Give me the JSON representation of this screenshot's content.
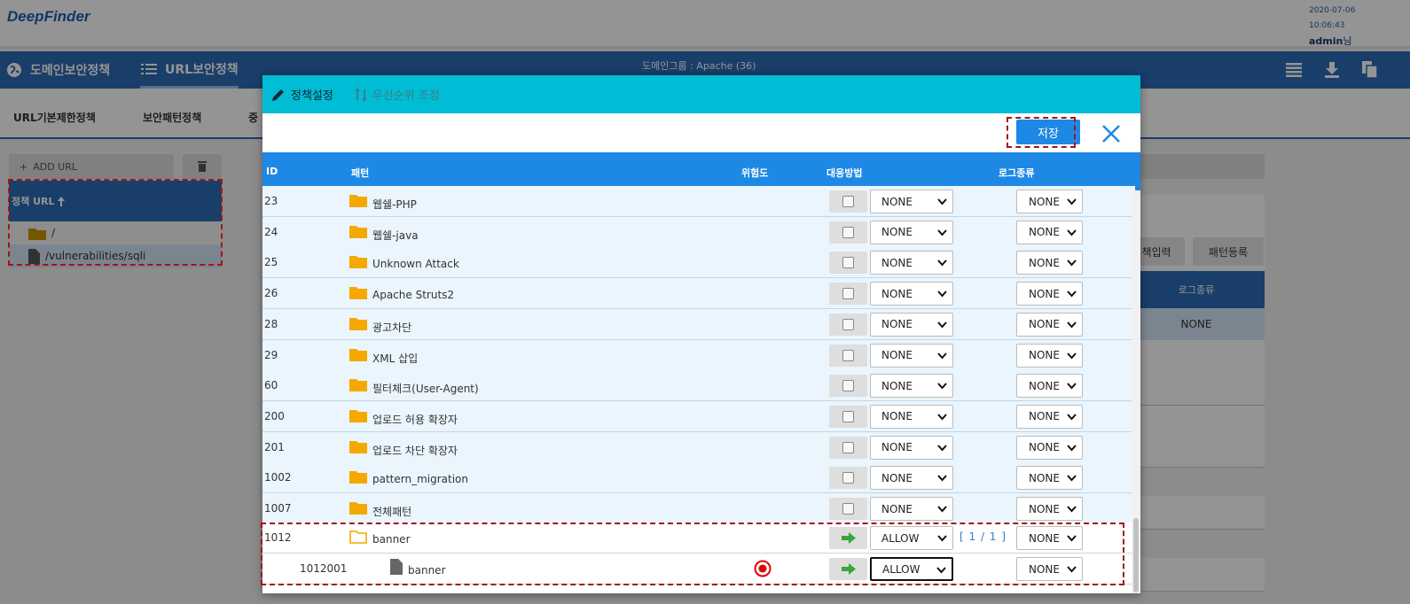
{
  "app": {
    "logo": "DeepFinder",
    "date": "2020-07-06",
    "time": "10:06:43",
    "user": "admin",
    "user_suffix": "님"
  },
  "nav": {
    "items": [
      {
        "label": "도메인보안정책",
        "icon": "globe-icon"
      },
      {
        "label": "URL보안정책",
        "icon": "list-icon"
      }
    ],
    "domain_group": "도메인그룹 : Apache (36)",
    "right_icons": [
      "table-icon",
      "download-icon",
      "copy-icon"
    ]
  },
  "subtabs": [
    "URL기본제한정책",
    "보안패턴정책",
    "중"
  ],
  "sidebar": {
    "add_url": "ADD URL",
    "tree_header": "정책 URL",
    "items": [
      {
        "label": "/",
        "icon": "folder-icon"
      },
      {
        "label": "/vulnerabilities/sqli",
        "icon": "file-icon"
      }
    ]
  },
  "right_panel": {
    "btn1": "책입력",
    "btn2": "패턴등록",
    "header": "로그종류",
    "value": "NONE"
  },
  "modal": {
    "tabs": [
      {
        "label": "정책설정",
        "icon": "pencil-icon"
      },
      {
        "label": "우선순위 조정",
        "icon": "sort-icon"
      }
    ],
    "save": "저장",
    "columns": {
      "id": "ID",
      "pattern": "패턴",
      "risk": "위험도",
      "action": "대응방법",
      "log": "로그종류"
    },
    "rows": [
      {
        "id": "23",
        "name": "웹쉘-PHP",
        "action": "NONE",
        "log": "NONE"
      },
      {
        "id": "24",
        "name": "웹쉘-java",
        "action": "NONE",
        "log": "NONE"
      },
      {
        "id": "25",
        "name": "Unknown Attack",
        "action": "NONE",
        "log": "NONE"
      },
      {
        "id": "26",
        "name": "Apache Struts2",
        "action": "NONE",
        "log": "NONE"
      },
      {
        "id": "28",
        "name": "광고차단",
        "action": "NONE",
        "log": "NONE"
      },
      {
        "id": "29",
        "name": "XML 삽입",
        "action": "NONE",
        "log": "NONE"
      },
      {
        "id": "60",
        "name": "필터체크(User-Agent)",
        "action": "NONE",
        "log": "NONE"
      },
      {
        "id": "200",
        "name": "업로드 허용 확장자",
        "action": "NONE",
        "log": "NONE"
      },
      {
        "id": "201",
        "name": "업로드 차단 확장자",
        "action": "NONE",
        "log": "NONE"
      },
      {
        "id": "1002",
        "name": "pattern_migration",
        "action": "NONE",
        "log": "NONE"
      },
      {
        "id": "1007",
        "name": "전체패턴",
        "action": "NONE",
        "log": "NONE"
      }
    ],
    "group_row": {
      "id": "1012",
      "name": "banner",
      "action": "ALLOW",
      "paging": "[ 1 / 1 ]",
      "log": "NONE"
    },
    "child_row": {
      "id": "1012001",
      "name": "banner",
      "action": "ALLOW",
      "log": "NONE"
    }
  },
  "colors": {
    "nav": "#2b6cb5",
    "modal_header": "#00bcd4",
    "table_header": "#1e88e5",
    "highlight": "#a31515",
    "folder": "#f5a900"
  }
}
